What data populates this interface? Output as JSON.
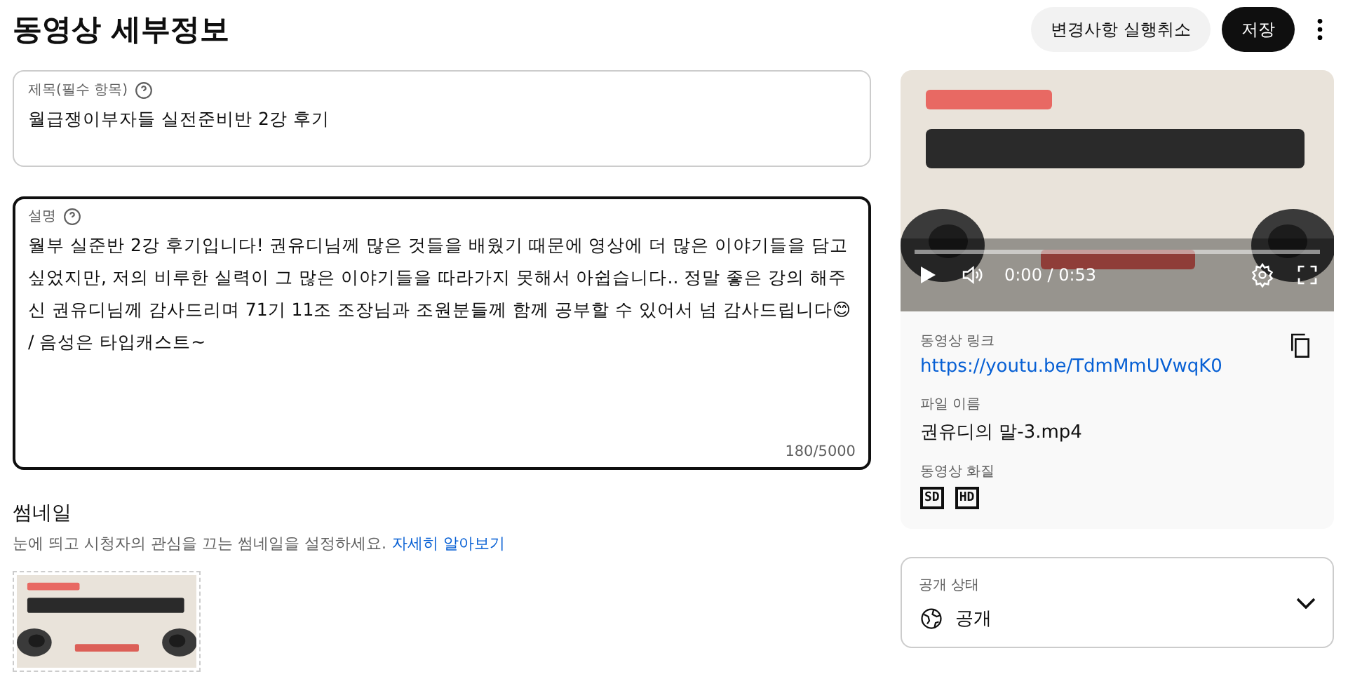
{
  "page": {
    "title": "동영상 세부정보"
  },
  "header_buttons": [
    {
      "label": "변경사항 실행취소",
      "kind": "secondary"
    },
    {
      "label": "저장",
      "kind": "primary"
    }
  ],
  "title_field": {
    "label": "제목(필수 항목)",
    "value": "월급쟁이부자들 실전준비반 2강 후기",
    "focused": false
  },
  "description_field": {
    "label": "설명",
    "value": "월부 실준반 2강 후기입니다! 권유디님께 많은 것들을 배웠기 때문에 영상에 더 많은 이야기들을 담고 싶었지만, 저의 비루한 실력이 그 많은 이야기들을 따라가지 못해서 아쉽습니다.. 정말 좋은 강의 해주신 권유디님께 감사드리며 71기 11조 조장님과 조원분들께 함께 공부할 수 있어서 넘 감사드립니다😊 / 음성은 타입캐스트~",
    "counter": "180/5000",
    "focused": true
  },
  "thumbnail": {
    "title": "썸네일",
    "description": "눈에 띄고 시청자의 관심을 끄는 썸네일을 설정하세요.",
    "link": "자세히 알아보기"
  },
  "player": {
    "time": "0:00 / 0:53",
    "level": 0.0
  },
  "details": [
    {
      "label": "동영상 링크",
      "value": "https://youtu.be/TdmMmUVwqK0",
      "kind": "link"
    },
    {
      "label": "파일 이름",
      "value": "권유디의 말-3.mp4",
      "kind": "text"
    },
    {
      "label": "동영상 화질",
      "kind": "quality",
      "badges": [
        "SD",
        "HD"
      ]
    }
  ],
  "visibility": {
    "label": "공개 상태",
    "value": "공개"
  }
}
